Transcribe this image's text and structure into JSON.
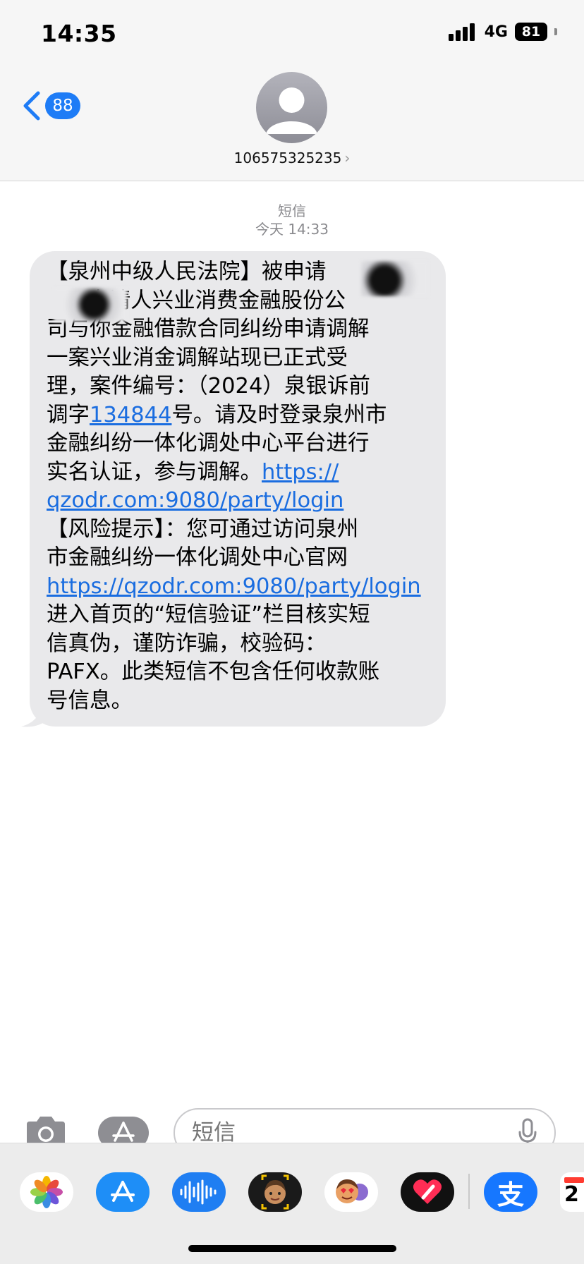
{
  "status_bar": {
    "time": "14:35",
    "network": "4G",
    "battery": "81"
  },
  "nav": {
    "back_count": "88",
    "contact": "106575325235"
  },
  "conversation": {
    "type_label": "短信",
    "timestamp": "今天 14:33",
    "message_lines": [
      [
        {
          "t": "【泉州中级人民法院】被申请"
        }
      ],
      [
        {
          "t": "      申请人兴业消费金融股份公"
        }
      ],
      [
        {
          "t": "司与你金融借款合同纠纷申请调解"
        }
      ],
      [
        {
          "t": "一案兴业消金调解站现已正式受"
        }
      ],
      [
        {
          "t": "理，案件编号：（2024）泉银诉前"
        }
      ],
      [
        {
          "t": "调字"
        },
        {
          "t": "134844",
          "link": true
        },
        {
          "t": "号。请及时登录泉州市"
        }
      ],
      [
        {
          "t": "金融纠纷一体化调处中心平台进行"
        }
      ],
      [
        {
          "t": "实名认证，参与调解。"
        },
        {
          "t": "https://",
          "link": true
        }
      ],
      [
        {
          "t": "qzodr.com:9080/party/login",
          "link": true
        }
      ],
      [
        {
          "t": "【风险提示】：您可通过访问泉州"
        }
      ],
      [
        {
          "t": "市金融纠纷一体化调处中心官网"
        }
      ],
      [
        {
          "t": "https://qzodr.com:9080/party/login",
          "link": true
        }
      ],
      [
        {
          "t": "进入首页的“短信验证”栏目核实短"
        }
      ],
      [
        {
          "t": "信真伪，谨防诈骗，校验码："
        }
      ],
      [
        {
          "t": "PAFX。此类短信不包含任何收款账"
        }
      ],
      [
        {
          "t": "号信息。"
        }
      ]
    ]
  },
  "composer": {
    "placeholder": "短信"
  },
  "app_drawer": {
    "apps": [
      "photos-icon",
      "app-store-icon",
      "audio-icon",
      "memoji-icon",
      "memoji-stickers-icon",
      "digital-touch-icon",
      "alipay-icon",
      "calendar-icon"
    ],
    "alipay_glyph": "支",
    "calendar_day": "2"
  },
  "colors": {
    "accent": "#1e7cf6",
    "bubble": "#e9e9eb",
    "link": "#1a6de0"
  }
}
